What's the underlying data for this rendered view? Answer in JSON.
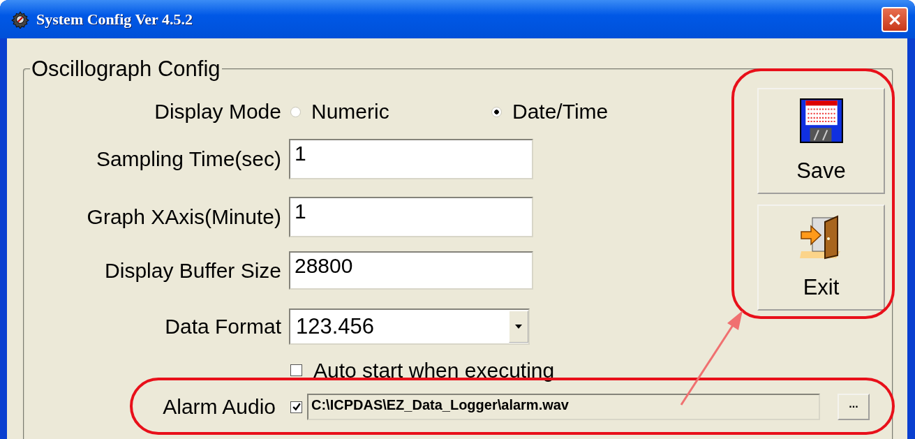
{
  "window": {
    "title": "System Config Ver 4.5.2"
  },
  "group": {
    "title": "Oscillograph Config"
  },
  "display_mode": {
    "label": "Display Mode",
    "options": [
      {
        "label": "Numeric",
        "selected": false
      },
      {
        "label": "Date/Time",
        "selected": true
      }
    ]
  },
  "fields": [
    {
      "label": "Sampling Time(sec)",
      "value": "1"
    },
    {
      "label": "Graph XAxis(Minute)",
      "value": "1"
    },
    {
      "label": "Display Buffer Size",
      "value": "28800"
    }
  ],
  "data_format": {
    "label": "Data Format",
    "value": "123.456"
  },
  "auto_start": {
    "label": "Auto start when executing",
    "checked": false
  },
  "alarm_audio": {
    "label": "Alarm Audio",
    "checked": true,
    "path": "C:\\ICPDAS\\EZ_Data_Logger\\alarm.wav",
    "browse": "..."
  },
  "buttons": [
    {
      "kind": "save",
      "label": "Save"
    },
    {
      "kind": "exit",
      "label": "Exit"
    }
  ]
}
